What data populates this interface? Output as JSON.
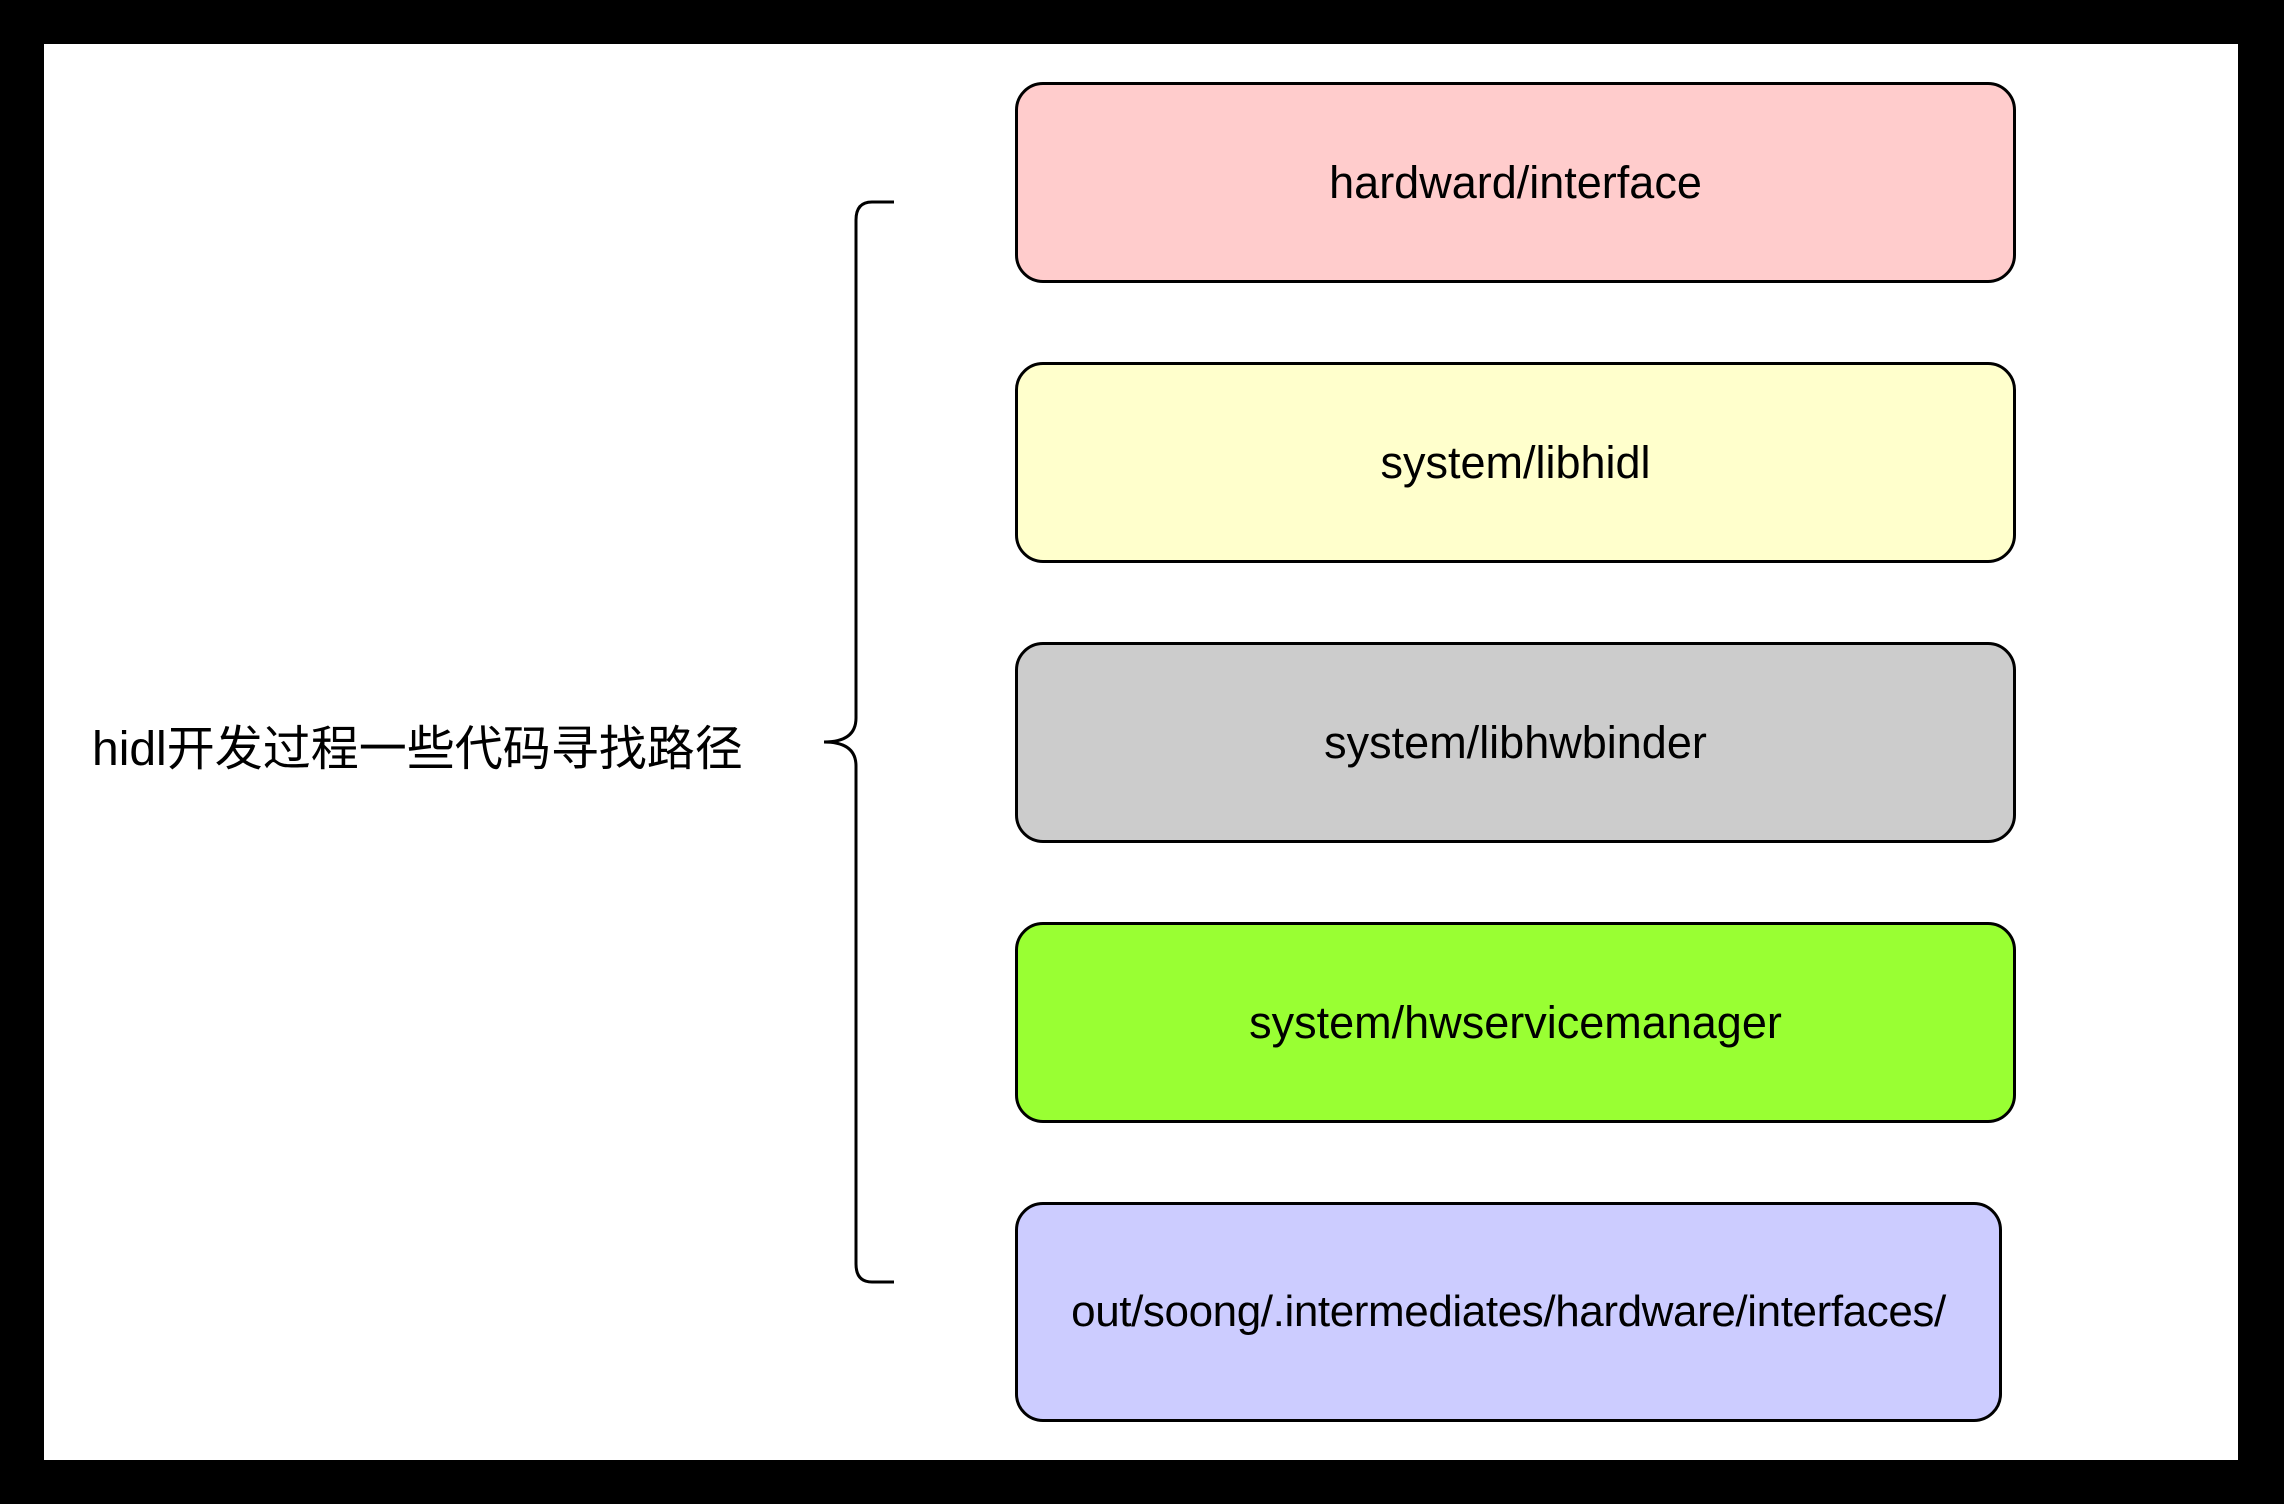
{
  "diagram": {
    "root": {
      "label": "hidl开发过程一些代码寻找路径"
    },
    "nodes": [
      {
        "label": "hardward/interface",
        "fill": "#ffcccc"
      },
      {
        "label": "system/libhidl",
        "fill": "#ffffcc"
      },
      {
        "label": "system/libhwbinder",
        "fill": "#cccccc"
      },
      {
        "label": "system/hwservicemanager",
        "fill": "#99ff33"
      },
      {
        "label": "out/soong/.intermediates/hardware/interfaces/",
        "fill": "#ccccff"
      }
    ]
  }
}
